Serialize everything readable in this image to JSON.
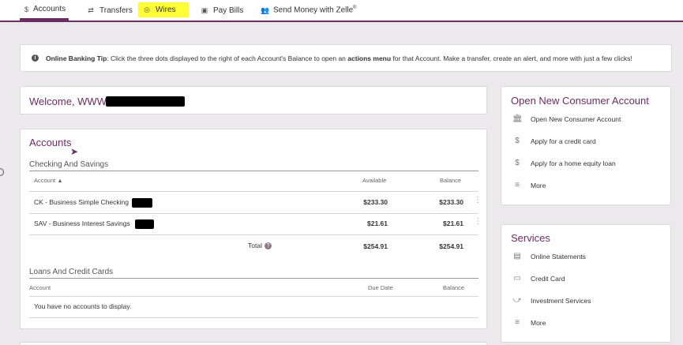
{
  "nav": {
    "accounts": "Accounts",
    "transfers": "Transfers",
    "wires": "Wires",
    "pay_bills": "Pay Bills",
    "zelle": "Send Money with Zelle",
    "zelle_mark": "®"
  },
  "tip": {
    "label": "Online Banking Tip",
    "text_a": ": Click the three dots displayed to the right of each Account's Balance to open an ",
    "menu": "actions menu",
    "text_b": " for that Account. Make a transfer, create an alert, and more with just a few clicks!"
  },
  "welcome": {
    "text": "Welcome, WWW"
  },
  "accounts": {
    "title": "Accounts",
    "checking_title": "Checking And Savings",
    "columns": {
      "account": "Account",
      "available": "Available",
      "balance": "Balance"
    },
    "rows": [
      {
        "name": "CK - Business Simple Checking",
        "available": "$233.30",
        "balance": "$233.30"
      },
      {
        "name": "SAV - Business Interest Savings",
        "available": "$21.61",
        "balance": "$21.61"
      }
    ],
    "total": {
      "label": "Total",
      "available": "$254.91",
      "balance": "$254.91"
    },
    "loans_title": "Loans And Credit Cards",
    "loans_columns": {
      "account": "Account",
      "due_date": "Due Date",
      "balance": "Balance"
    },
    "empty": "You have no accounts to display."
  },
  "open_account": {
    "title": "Open New Consumer Account",
    "items": [
      {
        "label": "Open New Consumer Account",
        "icon": "bank-icon"
      },
      {
        "label": "Apply for a credit card",
        "icon": "dollar-icon"
      },
      {
        "label": "Apply for a home equity loan",
        "icon": "dollar-icon"
      },
      {
        "label": "More",
        "icon": "menu-icon"
      }
    ]
  },
  "services": {
    "title": "Services",
    "items": [
      {
        "label": "Online Statements",
        "icon": "document-icon"
      },
      {
        "label": "Credit Card",
        "icon": "credit-card-icon"
      },
      {
        "label": "Investment Services",
        "icon": "chart-line-icon"
      },
      {
        "label": "More",
        "icon": "menu-icon"
      }
    ]
  },
  "colors": {
    "brand": "#6b2c63",
    "highlight": "#ffff33",
    "background": "#ebe9ec"
  }
}
